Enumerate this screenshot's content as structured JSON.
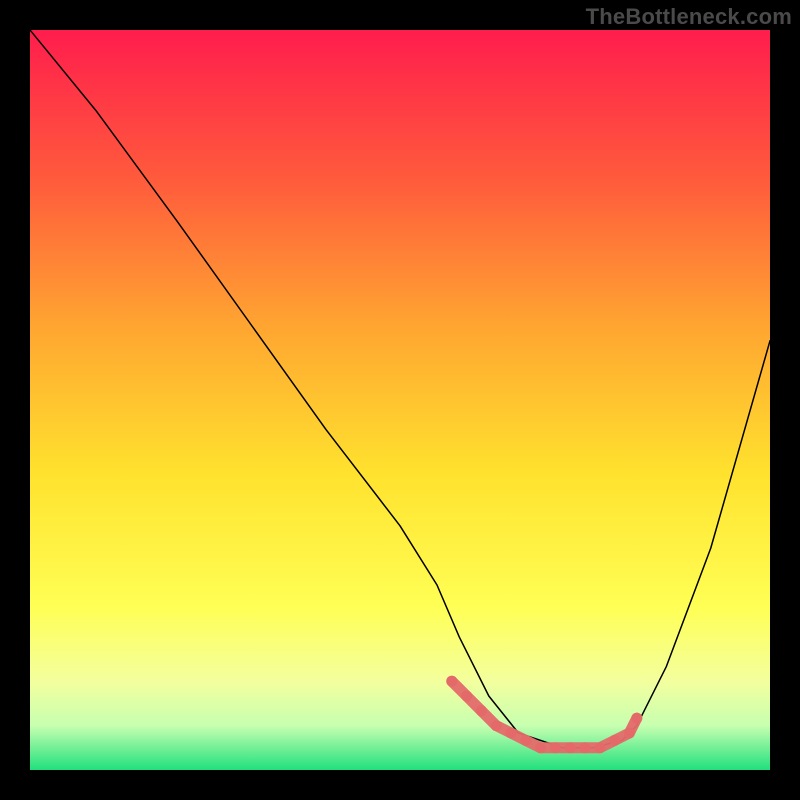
{
  "watermark": "TheBottleneck.com",
  "chart_data": {
    "type": "line",
    "title": "",
    "xlabel": "",
    "ylabel": "",
    "xlim": [
      0,
      100
    ],
    "ylim": [
      0,
      100
    ],
    "background_gradient": {
      "stops": [
        {
          "offset": 0.0,
          "color": "#ff1d4d"
        },
        {
          "offset": 0.2,
          "color": "#ff5a3c"
        },
        {
          "offset": 0.4,
          "color": "#ffa531"
        },
        {
          "offset": 0.6,
          "color": "#ffe22e"
        },
        {
          "offset": 0.78,
          "color": "#ffff55"
        },
        {
          "offset": 0.88,
          "color": "#f3ff9e"
        },
        {
          "offset": 0.94,
          "color": "#c7ffb0"
        },
        {
          "offset": 1.0,
          "color": "#21e07e"
        }
      ]
    },
    "series": [
      {
        "name": "bottleneck-curve",
        "color": "#000000",
        "width": 1.5,
        "x": [
          0,
          9,
          20,
          30,
          40,
          50,
          55,
          58,
          62,
          66,
          72,
          76,
          80,
          82,
          86,
          92,
          100
        ],
        "y": [
          100,
          89,
          74,
          60,
          46,
          33,
          25,
          18,
          10,
          5,
          3,
          3,
          4,
          6,
          14,
          30,
          58
        ]
      }
    ],
    "markers": {
      "name": "highlight-segment",
      "color": "#e46a6a",
      "radius": 5.5,
      "x": [
        57,
        59,
        61,
        63,
        65,
        67,
        69,
        71,
        73,
        75,
        77,
        79,
        81,
        82
      ],
      "y": [
        12,
        10,
        8,
        6,
        5,
        4,
        3,
        3,
        3,
        3,
        3,
        4,
        5,
        7
      ]
    }
  }
}
